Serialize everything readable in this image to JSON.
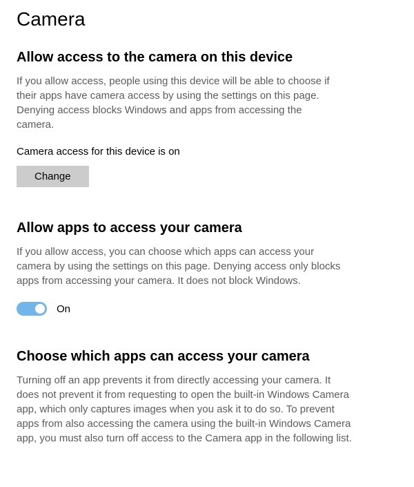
{
  "page": {
    "title": "Camera"
  },
  "sections": {
    "deviceAccess": {
      "title": "Allow access to the camera on this device",
      "description": "If you allow access, people using this device will be able to choose if their apps have camera access by using the settings on this page. Denying access blocks Windows and apps from accessing the camera.",
      "statusLabel": "Camera access for this device is on",
      "changeButton": "Change"
    },
    "appAccess": {
      "title": "Allow apps to access your camera",
      "description": "If you allow access, you can choose which apps can access your camera by using the settings on this page. Denying access only blocks apps from accessing your camera. It does not block Windows.",
      "toggleState": "On"
    },
    "chooseApps": {
      "title": "Choose which apps can access your camera",
      "description": "Turning off an app prevents it from directly accessing your camera. It does not prevent it from requesting to open the built-in Windows Camera app, which only captures images when you ask it to do so. To prevent apps from also accessing the camera using the built-in Windows Camera app, you must also turn off access to the Camera app in the following list."
    }
  }
}
